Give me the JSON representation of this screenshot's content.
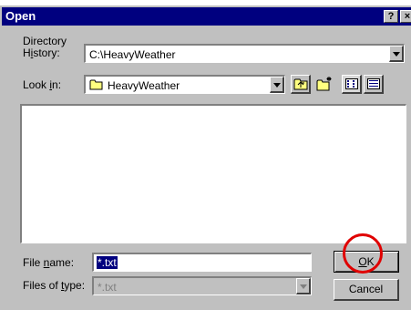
{
  "dialog": {
    "title": "Open",
    "help_label": "?",
    "close_label": "×"
  },
  "directory_history": {
    "label_line1": "Directory",
    "label_line2_prefix": "H",
    "label_line2_mnemonic": "i",
    "label_line2_suffix": "story:",
    "value": "C:\\HeavyWeather"
  },
  "look_in": {
    "label_prefix": "Look ",
    "label_mnemonic": "i",
    "label_suffix": "n:",
    "value": "HeavyWeather"
  },
  "toolbar": {
    "icons": [
      "up-one-level-icon",
      "create-new-folder-icon",
      "list-view-icon",
      "details-view-icon"
    ]
  },
  "file_name": {
    "label_prefix": "File ",
    "label_mnemonic": "n",
    "label_suffix": "ame:",
    "value": "*.txt"
  },
  "files_of_type": {
    "label_prefix": "Files of ",
    "label_mnemonic": "t",
    "label_suffix": "ype:",
    "value": "*.txt"
  },
  "buttons": {
    "ok_mnemonic": "O",
    "ok_suffix": "K",
    "cancel_label": "Cancel"
  },
  "annotation": {
    "circle_color": "#e00000"
  }
}
